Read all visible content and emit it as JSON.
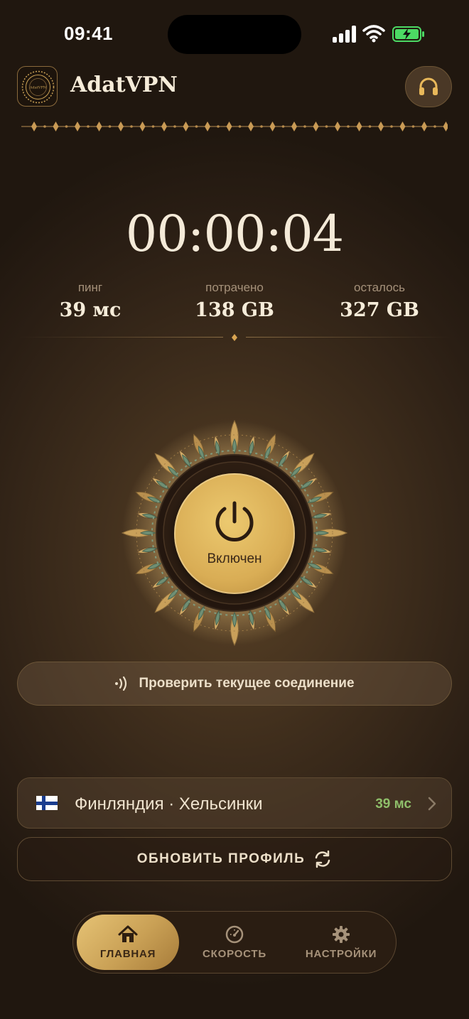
{
  "status_bar": {
    "time": "09:41"
  },
  "header": {
    "app_name": "AdatVPN",
    "logo_text": "AdatVPN"
  },
  "session": {
    "timer": "00:00:04"
  },
  "stats": [
    {
      "label": "пинг",
      "value": "39 мс"
    },
    {
      "label": "потрачено",
      "value": "138 GB"
    },
    {
      "label": "осталось",
      "value": "327 GB"
    }
  ],
  "power": {
    "state_label": "Включен"
  },
  "actions": {
    "check_connection": "Проверить текущее соединение",
    "refresh_profile": "ОБНОВИТЬ ПРОФИЛЬ"
  },
  "server": {
    "location": "Финляндия · Хельсинки",
    "ping": "39 мс"
  },
  "tabs": [
    {
      "label": "ГЛАВНАЯ",
      "icon": "home-icon",
      "active": true
    },
    {
      "label": "СКОРОСТЬ",
      "icon": "speedometer-icon",
      "active": false
    },
    {
      "label": "НАСТРОЙКИ",
      "icon": "gear-icon",
      "active": false
    }
  ],
  "colors": {
    "accent_gold": "#d9ad55",
    "ping_green": "#8fbf6a",
    "background": "#3e2d1c"
  }
}
